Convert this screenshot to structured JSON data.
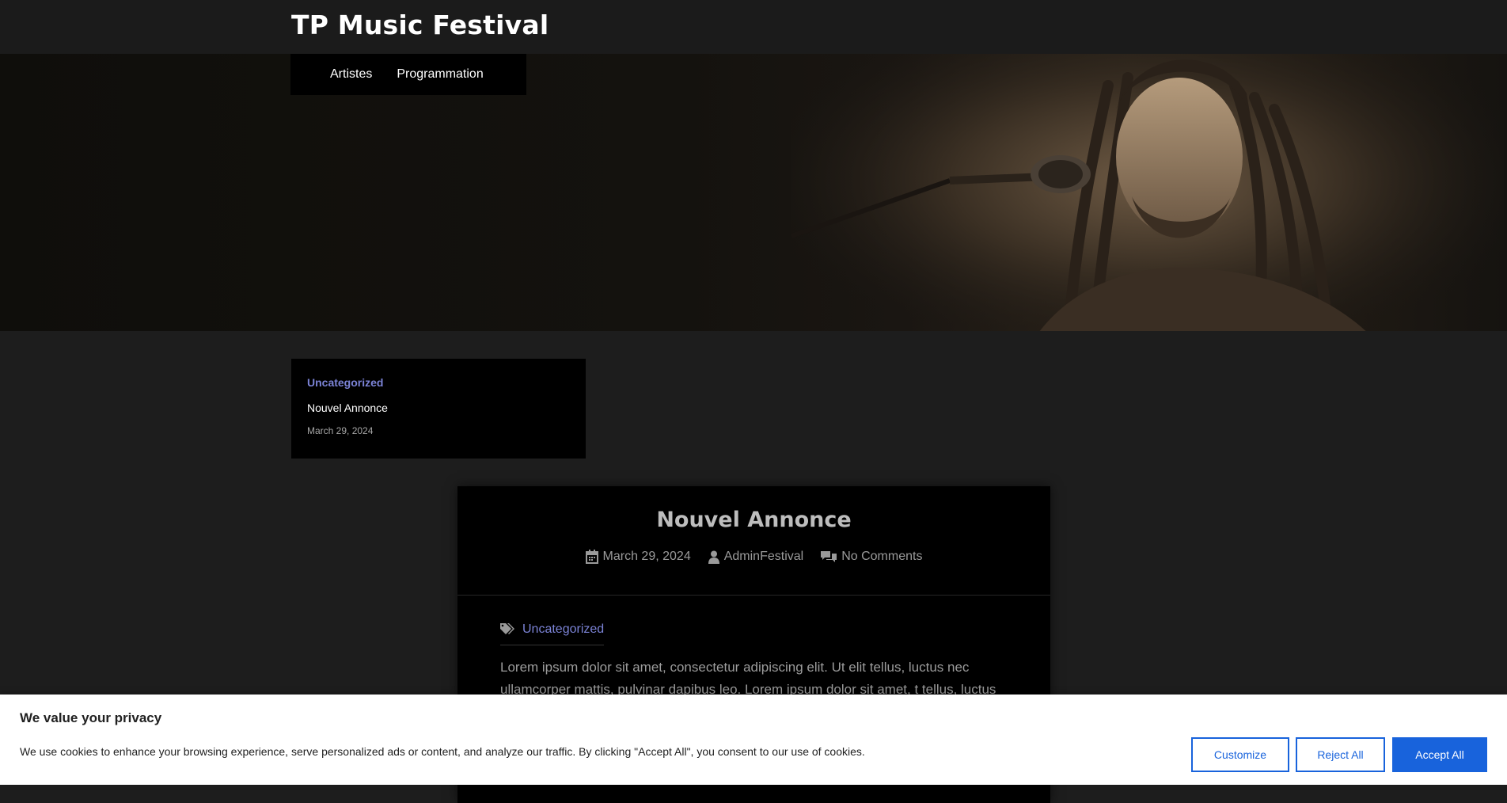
{
  "site": {
    "title": "TP Music Festival"
  },
  "nav": {
    "items": [
      {
        "label": "Artistes"
      },
      {
        "label": "Programmation"
      }
    ]
  },
  "recent_post": {
    "category": "Uncategorized",
    "title": "Nouvel Annonce",
    "date": "March 29, 2024"
  },
  "article": {
    "title": "Nouvel Annonce",
    "date": "March 29, 2024",
    "author": "AdminFestival",
    "comments": "No Comments",
    "category": "Uncategorized",
    "excerpt": "Lorem ipsum dolor sit amet, consectetur adipiscing elit. Ut elit tellus, luctus nec ullamcorper mattis, pulvinar dapibus leo. Lorem ipsum dolor sit amet, t tellus, luctus nec"
  },
  "cookie": {
    "title": "We value your privacy",
    "text": "We use cookies to enhance your browsing experience, serve personalized ads or content, and analyze our traffic. By clicking \"Accept All\", you consent to our use of cookies.",
    "customize_label": "Customize",
    "reject_label": "Reject All",
    "accept_label": "Accept All"
  },
  "colors": {
    "accent": "#7b83d6",
    "cookie_button": "#1863dc",
    "background": "#1d1d1d"
  },
  "icons": [
    "calendar-icon",
    "user-icon",
    "comments-icon",
    "tags-icon"
  ]
}
